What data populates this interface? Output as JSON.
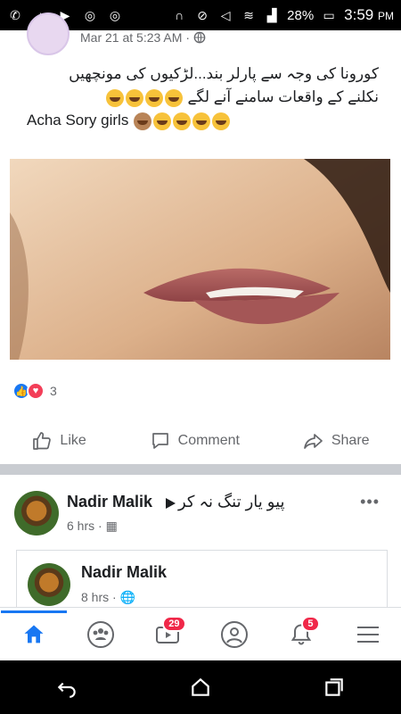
{
  "status_bar": {
    "battery": "28%",
    "time": "3:59",
    "time_suffix": "PM"
  },
  "post1": {
    "timestamp": "Mar 21 at 5:23 AM",
    "urdu_line1": "کورونا کی وجہ سے پارلر بند...لڑکیوں کی مونچھیں",
    "urdu_line2": "نکلنے کے واقعات سامنے آنے لگے",
    "english_line": "Acha Sory girls",
    "reaction_count": "3",
    "actions": {
      "like": "Like",
      "comment": "Comment",
      "share": "Share"
    }
  },
  "post2": {
    "author": "Nadir Malik",
    "urdu_text": "پیو یار تنگ نہ کر",
    "time": "6 hrs",
    "shared_author": "Nadir Malik",
    "shared_time": "8 hrs"
  },
  "nav": {
    "video_badge": "29",
    "notifications_badge": "5"
  },
  "colors": {
    "accent": "#1877f2",
    "badge": "#f02849"
  }
}
